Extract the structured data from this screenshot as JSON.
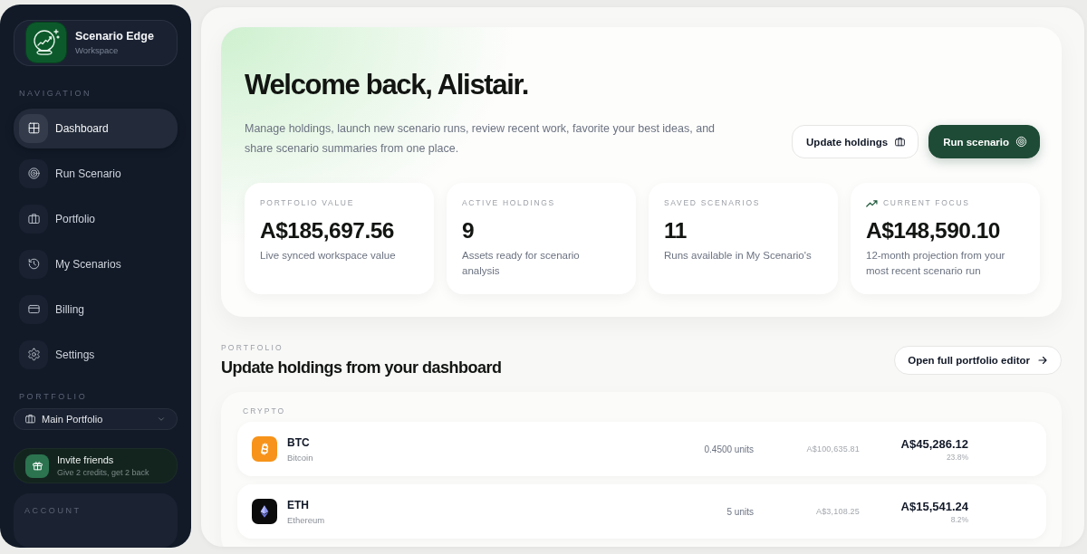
{
  "sidebar": {
    "brand": {
      "name": "Scenario Edge",
      "subtitle": "Workspace"
    },
    "nav_heading": "NAVIGATION",
    "nav_items": [
      {
        "label": "Dashboard",
        "selected": true
      },
      {
        "label": "Run Scenario",
        "selected": false
      },
      {
        "label": "Portfolio",
        "selected": false
      },
      {
        "label": "My Scenarios",
        "selected": false
      },
      {
        "label": "Billing",
        "selected": false
      },
      {
        "label": "Settings",
        "selected": false
      }
    ],
    "portfolio_heading": "PORTFOLIO",
    "portfolio_select": {
      "value": "Main Portfolio"
    },
    "invite": {
      "title": "Invite friends",
      "subtitle": "Give 2 credits, get 2 back"
    },
    "account_heading": "ACCOUNT"
  },
  "hero": {
    "title": "Welcome back, Alistair.",
    "description": "Manage holdings, launch new scenario runs, review recent work, favorite your best ideas, and share scenario summaries from one place.",
    "buttons": [
      {
        "label": "Update holdings",
        "kind": "secondary"
      },
      {
        "label": "Run scenario",
        "kind": "primary"
      }
    ],
    "stats": [
      {
        "kind": "metric",
        "label": "PORTFOLIO VALUE",
        "value": "A$185,697.56",
        "note": "Live synced workspace value"
      },
      {
        "kind": "metric",
        "label": "ACTIVE HOLDINGS",
        "value": "9",
        "note": "Assets ready for scenario analysis"
      },
      {
        "kind": "metric",
        "label": "SAVED SCENARIOS",
        "value": "11",
        "note": "Runs available in My Scenario's"
      },
      {
        "kind": "projection",
        "label": "CURRENT FOCUS",
        "value": "A$148,590.10",
        "note": "12-month projection from your most recent scenario run"
      }
    ]
  },
  "portfolio": {
    "label": "PORTFOLIO",
    "title": "Update holdings from your dashboard",
    "action": "Open full portfolio editor",
    "groups": [
      {
        "name": "CRYPTO",
        "holdings": [
          {
            "symbol": "BTC",
            "name": "Bitcoin",
            "units": "0.4500 units",
            "price": "A$100,635.81",
            "value": "A$45,286.12",
            "share": "23.8%",
            "color": "#f7931a"
          },
          {
            "symbol": "ETH",
            "name": "Ethereum",
            "units": "5 units",
            "price": "A$3,108.25",
            "value": "A$15,541.24",
            "share": "8.2%",
            "color": "#0b0b0c"
          }
        ]
      }
    ]
  }
}
